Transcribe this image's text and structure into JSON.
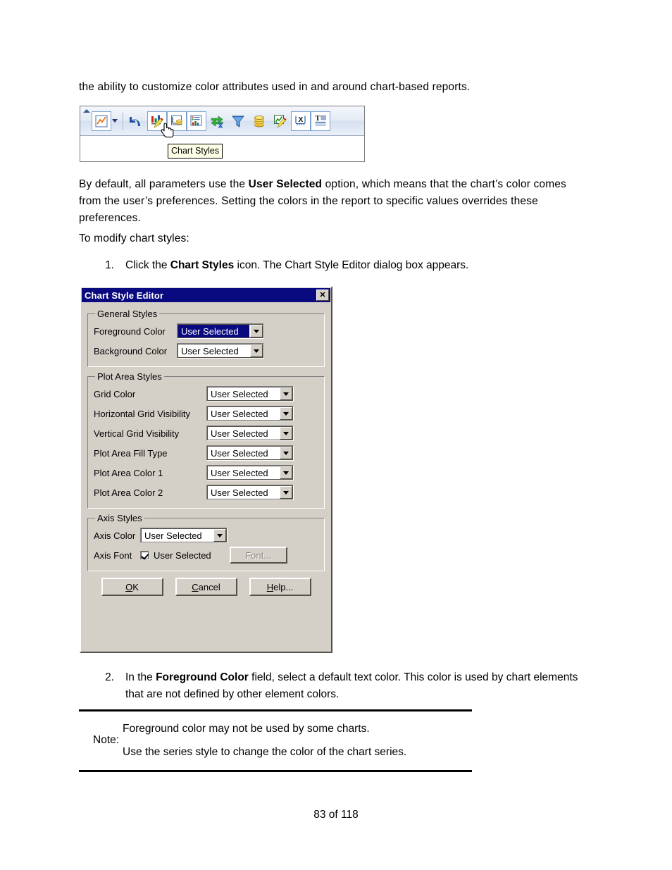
{
  "document": {
    "intro_line": "the ability to customize color attributes used in and around chart-based reports.",
    "default_para_before": "By default, all parameters use the ",
    "default_para_bold": "User Selected",
    "default_para_after": " option, which means that the chart’s color comes from the user’s preferences. Setting the colors in the report to specific values overrides these preferences.",
    "to_modify_heading": "To modify chart styles:",
    "steps": [
      {
        "number": "1.",
        "before": "Click the ",
        "bold": "Chart Styles",
        "after": " icon. The Chart Style Editor dialog box appears."
      },
      {
        "number": "2.",
        "before": "In the ",
        "bold": "Foreground Color",
        "after": " field, select a default text color. This color is used by chart elements that are not defined by other element colors."
      }
    ],
    "note": {
      "label": "Note:",
      "lines": [
        "Foreground color may not be used by some charts.",
        "Use the series style to change the color of the chart series."
      ]
    },
    "footer": "83 of 118"
  },
  "toolbar_figure": {
    "tooltip": "Chart Styles",
    "buttons": [
      {
        "name": "chart-type-icon",
        "title": "Chart Type"
      },
      {
        "name": "undo-icon",
        "title": "Undo"
      },
      {
        "name": "chart-styles-icon",
        "title": "Chart Styles"
      },
      {
        "name": "chart-data-icon",
        "title": "Chart Data"
      },
      {
        "name": "chart-legend-icon",
        "title": "Chart Legend"
      },
      {
        "name": "swap-rows-columns-icon",
        "title": "Swap Rows and Columns"
      },
      {
        "name": "filter-icon",
        "title": "Filter"
      },
      {
        "name": "database-icon",
        "title": "Database"
      },
      {
        "name": "edit-chart-icon",
        "title": "Edit Chart"
      },
      {
        "name": "x-axis-icon",
        "title": "X Axis"
      },
      {
        "name": "title-text-icon",
        "title": "Title Text"
      }
    ]
  },
  "dialog": {
    "title": "Chart Style Editor",
    "close_label": "✕",
    "groups": [
      {
        "legend": "General Styles",
        "rows": [
          {
            "label": "Foreground Color",
            "value": "User Selected",
            "selected": true
          },
          {
            "label": "Background Color",
            "value": "User Selected",
            "selected": false
          }
        ]
      },
      {
        "legend": "Plot Area Styles",
        "rows": [
          {
            "label": "Grid Color",
            "value": "User Selected",
            "selected": false
          },
          {
            "label": "Horizontal Grid Visibility",
            "value": "User Selected",
            "selected": false
          },
          {
            "label": "Vertical Grid Visibility",
            "value": "User Selected",
            "selected": false
          },
          {
            "label": "Plot Area Fill Type",
            "value": "User Selected",
            "selected": false
          },
          {
            "label": "Plot Area Color 1",
            "value": "User Selected",
            "selected": false
          },
          {
            "label": "Plot Area Color 2",
            "value": "User Selected",
            "selected": false
          }
        ]
      },
      {
        "legend": "Axis Styles",
        "axis_color_label": "Axis Color",
        "axis_color_value": "User Selected",
        "axis_font_label": "Axis Font",
        "axis_font_checkbox_label": "User Selected",
        "axis_font_checked": true,
        "font_button": "Font..."
      }
    ],
    "buttons": {
      "ok": "OK",
      "ok_mnemonic": "O",
      "ok_rest": "K",
      "cancel_mnemonic": "C",
      "cancel_rest": "ancel",
      "help_mnemonic": "H",
      "help_rest": "elp..."
    }
  },
  "colors": {
    "titlebar": "#0a0a80",
    "dialog_face": "#d4d0c8",
    "selection": "#0a0a80",
    "selection_text": "#ffffff",
    "note_rule": "#000000"
  }
}
